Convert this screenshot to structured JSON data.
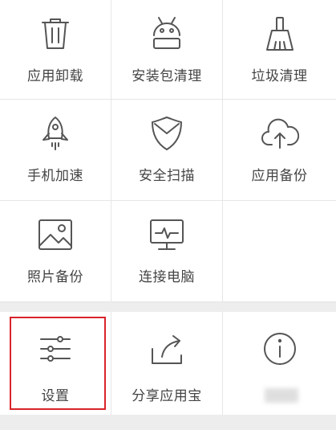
{
  "tools": [
    {
      "label": "应用卸载",
      "icon": "trash-icon"
    },
    {
      "label": "安装包清理",
      "icon": "android-icon"
    },
    {
      "label": "垃圾清理",
      "icon": "broom-icon"
    },
    {
      "label": "手机加速",
      "icon": "rocket-icon"
    },
    {
      "label": "安全扫描",
      "icon": "shield-icon"
    },
    {
      "label": "应用备份",
      "icon": "cloud-upload-icon"
    },
    {
      "label": "照片备份",
      "icon": "image-icon"
    },
    {
      "label": "连接电脑",
      "icon": "monitor-icon"
    }
  ],
  "bottom": [
    {
      "label": "设置",
      "icon": "sliders-icon"
    },
    {
      "label": "分享应用宝",
      "icon": "share-icon"
    },
    {
      "label": "",
      "icon": "info-icon"
    }
  ],
  "colors": {
    "highlight": "#d8242a",
    "icon_stroke": "#555555",
    "background": "#ededed"
  }
}
